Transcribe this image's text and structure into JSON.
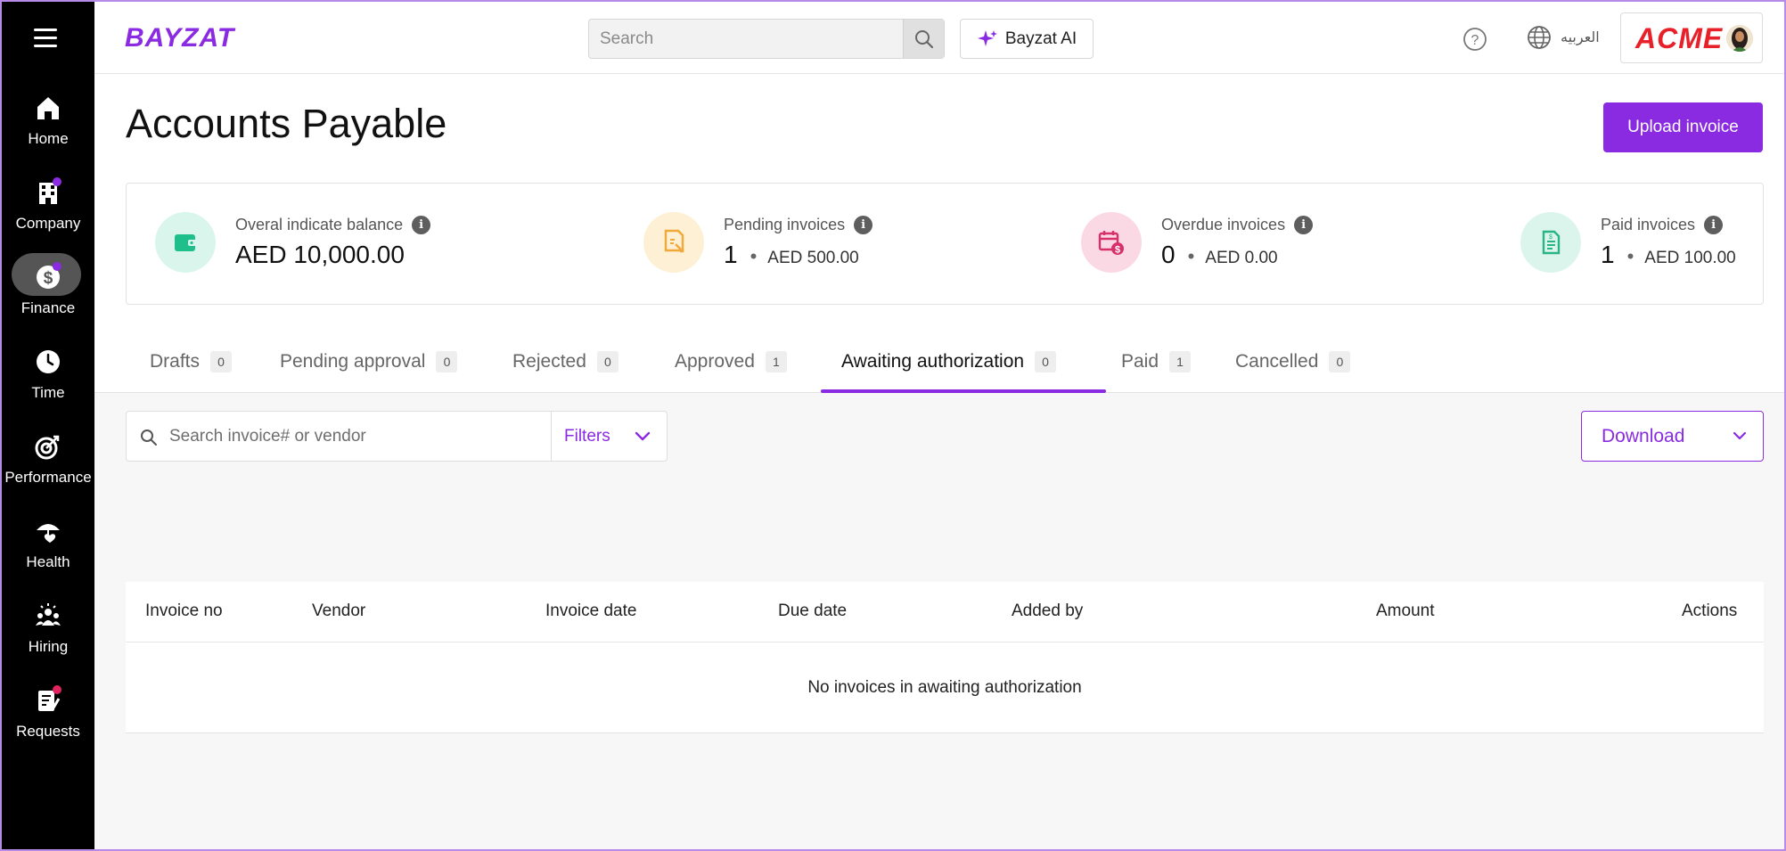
{
  "colors": {
    "brand": "#8a2be2",
    "acme_red": "#e8202a",
    "wallet_bg": "#d9f5ec",
    "wallet_fg": "#1fbf8c",
    "pending_bg": "#fdf0d5",
    "pending_fg": "#f0a93a",
    "overdue_bg": "#fbd9e4",
    "overdue_fg": "#d6316a",
    "paid_bg": "#dcf5ec",
    "paid_fg": "#28b487"
  },
  "sidebar": {
    "items": [
      {
        "label": "Home",
        "icon": "home-icon"
      },
      {
        "label": "Company",
        "icon": "building-icon",
        "dot": "#8a2be2"
      },
      {
        "label": "Finance",
        "icon": "dollar-coin-icon",
        "active": true,
        "dot": "#8a2be2"
      },
      {
        "label": "Time",
        "icon": "clock-icon"
      },
      {
        "label": "Performance",
        "icon": "target-icon"
      },
      {
        "label": "Health",
        "icon": "umbrella-heart-icon"
      },
      {
        "label": "Hiring",
        "icon": "people-icon"
      },
      {
        "label": "Requests",
        "icon": "clipboard-edit-icon",
        "dot": "#e0245e"
      }
    ]
  },
  "header": {
    "logo": "BAYZAT",
    "search_placeholder": "Search",
    "ai_label": "Bayzat AI",
    "language": "العربيه",
    "company_logo": "ACME"
  },
  "page": {
    "title": "Accounts Payable",
    "upload_label": "Upload invoice"
  },
  "stats": [
    {
      "label": "Overal indicate balance",
      "value": "AED 10,000.00",
      "icon": "wallet-icon"
    },
    {
      "label": "Pending invoices",
      "count": "1",
      "amount": "AED 500.00",
      "icon": "pending-invoice-icon"
    },
    {
      "label": "Overdue invoices",
      "count": "0",
      "amount": "AED 0.00",
      "icon": "overdue-calendar-icon"
    },
    {
      "label": "Paid invoices",
      "count": "1",
      "amount": "AED 100.00",
      "icon": "paid-document-icon"
    }
  ],
  "tabs": [
    {
      "label": "Drafts",
      "count": "0"
    },
    {
      "label": "Pending approval",
      "count": "0"
    },
    {
      "label": "Rejected",
      "count": "0"
    },
    {
      "label": "Approved",
      "count": "1"
    },
    {
      "label": "Awaiting authorization",
      "count": "0",
      "active": true
    },
    {
      "label": "Paid",
      "count": "1"
    },
    {
      "label": "Cancelled",
      "count": "0"
    }
  ],
  "toolbar": {
    "search_placeholder": "Search invoice# or vendor",
    "filters_label": "Filters",
    "download_label": "Download"
  },
  "table": {
    "columns": [
      "Invoice no",
      "Vendor",
      "Invoice date",
      "Due date",
      "Added by",
      "Amount",
      "Actions"
    ],
    "empty_message": "No invoices in awaiting authorization"
  }
}
